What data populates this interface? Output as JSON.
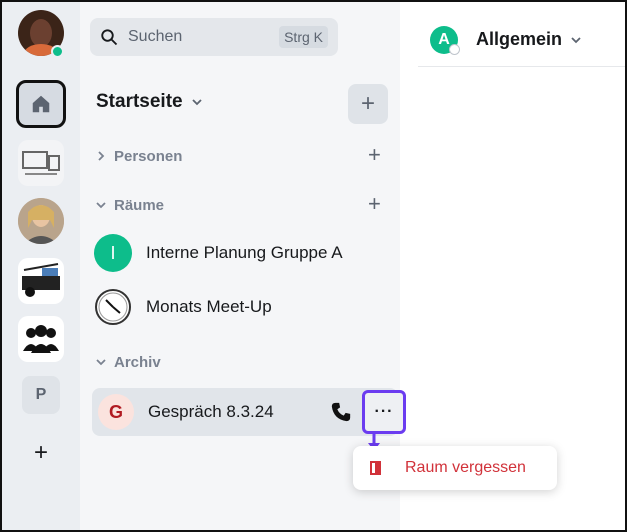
{
  "search": {
    "placeholder": "Suchen",
    "shortcut": "Strg K"
  },
  "home": {
    "title": "Startseite"
  },
  "sections": {
    "people": "Personen",
    "rooms": "Räume",
    "archive": "Archiv"
  },
  "rooms": [
    {
      "name": "Interne Planung Gruppe A",
      "initial": "I"
    },
    {
      "name": "Monats Meet-Up"
    }
  ],
  "archived": [
    {
      "name": "Gespräch 8.3.24",
      "initial": "G"
    }
  ],
  "context_menu": {
    "items": [
      {
        "label": "Raum vergessen"
      }
    ]
  },
  "spaces": [
    {
      "initial": "P"
    }
  ],
  "header": {
    "room_title": "Allgemein",
    "room_initial": "A"
  },
  "colors": {
    "accent": "#0dbd8b",
    "highlight": "#6b3cf0",
    "danger": "#d1323a"
  }
}
